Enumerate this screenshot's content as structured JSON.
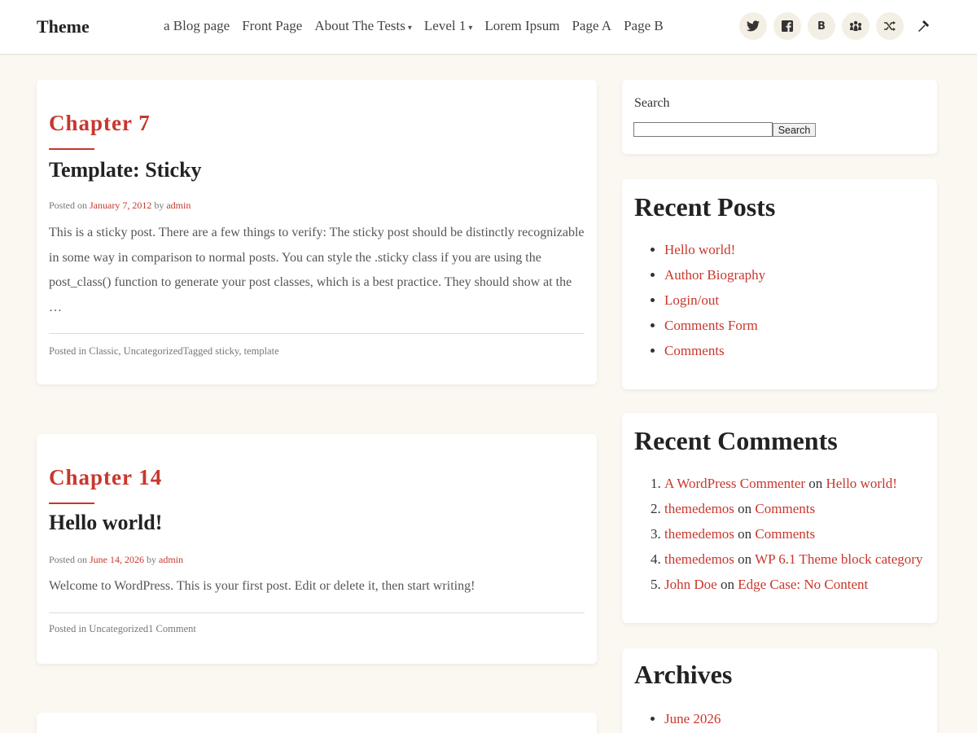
{
  "header": {
    "site_title": "Theme",
    "nav": [
      {
        "label": "a Blog page",
        "dropdown": false
      },
      {
        "label": "Front Page",
        "dropdown": false
      },
      {
        "label": "About The Tests",
        "dropdown": true
      },
      {
        "label": "Level 1",
        "dropdown": true
      },
      {
        "label": "Lorem Ipsum",
        "dropdown": false
      },
      {
        "label": "Page A",
        "dropdown": false
      },
      {
        "label": "Page B",
        "dropdown": false
      }
    ],
    "caret": "▾",
    "social_icons": [
      "twitter-icon",
      "facebook-icon",
      "behance-icon",
      "meetup-icon",
      "random-icon",
      "hammer-icon"
    ],
    "behance_glyph": "B"
  },
  "posts": [
    {
      "chapter": "Chapter 7",
      "title": "Template: Sticky",
      "posted_on": "Posted on ",
      "date": "January 7, 2012",
      "by": " by ",
      "author": "admin",
      "excerpt": "This is a sticky post. There are a few things to verify: The sticky post should be distinctly recognizable in some way in comparison to normal posts. You can style the .sticky class if you are using the post_class() function to generate your post classes, which is a best practice. They should show at the …",
      "footer": "Posted in Classic, UncategorizedTagged sticky, template"
    },
    {
      "chapter": "Chapter 14",
      "title": "Hello world!",
      "posted_on": "Posted on ",
      "date": "June 14, 2026",
      "by": " by ",
      "author": "admin",
      "excerpt": "Welcome to WordPress. This is your first post. Edit or delete it, then start writing!",
      "footer": "Posted in Uncategorized1 Comment"
    }
  ],
  "sidebar": {
    "search": {
      "label": "Search",
      "button": "Search",
      "value": ""
    },
    "recent_posts": {
      "title": "Recent Posts",
      "items": [
        "Hello world!",
        "Author Biography",
        "Login/out",
        "Comments Form",
        "Comments"
      ]
    },
    "recent_comments": {
      "title": "Recent Comments",
      "items": [
        {
          "author": "A WordPress Commenter",
          "on": " on ",
          "post": "Hello world!"
        },
        {
          "author": "themedemos",
          "on": " on ",
          "post": "Comments"
        },
        {
          "author": "themedemos",
          "on": " on ",
          "post": "Comments"
        },
        {
          "author": "themedemos",
          "on": " on ",
          "post": "WP 6.1 Theme block category"
        },
        {
          "author": "John Doe",
          "on": " on ",
          "post": "Edge Case: No Content"
        }
      ]
    },
    "archives": {
      "title": "Archives",
      "items": [
        "June 2026"
      ]
    }
  },
  "colors": {
    "accent": "#c8372d",
    "background": "#fbf8f1",
    "card": "#ffffff"
  }
}
